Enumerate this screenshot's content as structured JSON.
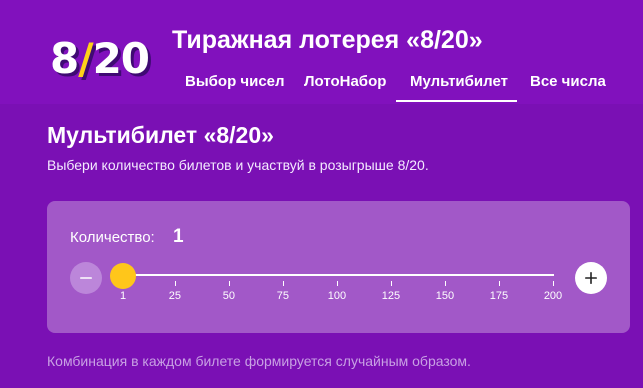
{
  "header": {
    "logo_left": "8",
    "logo_slash": "/",
    "logo_right": "20",
    "title": "Тиражная лотерея «8/20»",
    "tabs": [
      {
        "label": "Выбор чисел",
        "active": false
      },
      {
        "label": "ЛотоНабор",
        "active": false
      },
      {
        "label": "Мультибилет",
        "active": true
      },
      {
        "label": "Все числа",
        "active": false
      }
    ]
  },
  "main": {
    "title": "Мультибилет «8/20»",
    "subtitle": "Выбери количество билетов и участвуй в розыгрыше 8/20.",
    "quantity_label": "Количество:",
    "quantity_value": "1",
    "slider": {
      "min": 1,
      "max": 200,
      "value": 1,
      "ticks": [
        "1",
        "25",
        "50",
        "75",
        "100",
        "125",
        "150",
        "175",
        "200"
      ]
    },
    "footnote": "Комбинация в каждом билете формируется случайным образом."
  },
  "colors": {
    "background": "#7a10b4",
    "card": "#a258c8",
    "accent": "#ffc61a",
    "minus_button": "#bc86da"
  },
  "icons": {
    "minus": "minus-icon",
    "plus": "plus-icon"
  }
}
